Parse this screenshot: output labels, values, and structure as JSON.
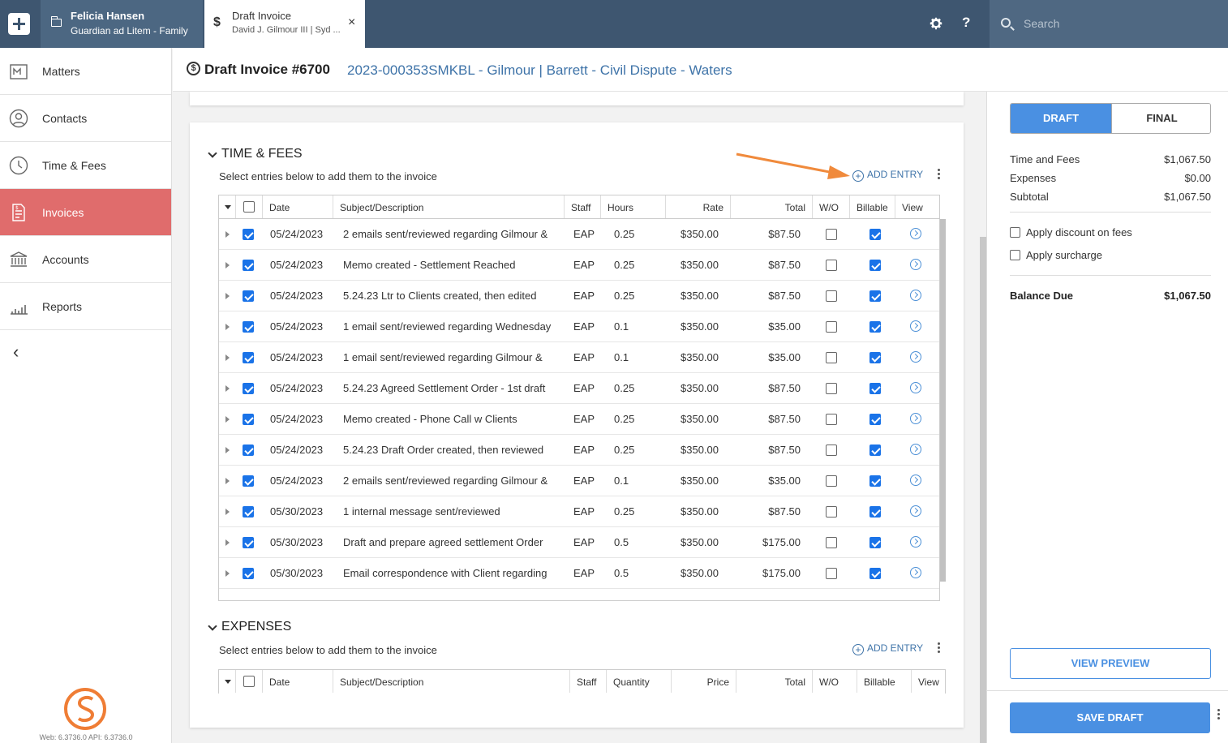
{
  "topbar": {
    "matter_tab": {
      "name": "Felicia Hansen",
      "subtitle": "Guardian ad Litem - Family"
    },
    "invoice_tab": {
      "title": "Draft Invoice",
      "subtitle": "David J. Gilmour III | Syd ...",
      "icon": "$",
      "close": "×"
    },
    "help": "?",
    "search_placeholder": "Search"
  },
  "sidebar": {
    "items": [
      {
        "label": "Matters",
        "icon": "matters-icon"
      },
      {
        "label": "Contacts",
        "icon": "contacts-icon"
      },
      {
        "label": "Time & Fees",
        "icon": "clock-icon"
      },
      {
        "label": "Invoices",
        "icon": "invoice-icon",
        "active": true
      },
      {
        "label": "Accounts",
        "icon": "bank-icon"
      },
      {
        "label": "Reports",
        "icon": "reports-icon"
      }
    ],
    "collapse": "‹",
    "version": "Web: 6.3736.0 API: 6.3736.0"
  },
  "header": {
    "info": "$",
    "title": "Draft Invoice #6700",
    "matter_link": "2023-000353SMKBL - Gilmour | Barrett - Civil Dispute - Waters"
  },
  "time_fees": {
    "title": "TIME & FEES",
    "subtitle": "Select entries below to add them to the invoice",
    "add_entry": "ADD ENTRY",
    "columns": {
      "date": "Date",
      "subject": "Subject/Description",
      "staff": "Staff",
      "hours": "Hours",
      "rate": "Rate",
      "total": "Total",
      "wo": "W/O",
      "billable": "Billable",
      "view": "View"
    },
    "rows": [
      {
        "date": "05/24/2023",
        "subject": "2 emails sent/reviewed regarding Gilmour &",
        "staff": "EAP",
        "hours": "0.25",
        "rate": "$350.00",
        "total": "$87.50",
        "selected": true,
        "wo": false,
        "billable": true
      },
      {
        "date": "05/24/2023",
        "subject": "Memo created - Settlement Reached",
        "staff": "EAP",
        "hours": "0.25",
        "rate": "$350.00",
        "total": "$87.50",
        "selected": true,
        "wo": false,
        "billable": true
      },
      {
        "date": "05/24/2023",
        "subject": "5.24.23 Ltr to Clients created, then edited",
        "staff": "EAP",
        "hours": "0.25",
        "rate": "$350.00",
        "total": "$87.50",
        "selected": true,
        "wo": false,
        "billable": true
      },
      {
        "date": "05/24/2023",
        "subject": "1 email sent/reviewed regarding Wednesday",
        "staff": "EAP",
        "hours": "0.1",
        "rate": "$350.00",
        "total": "$35.00",
        "selected": true,
        "wo": false,
        "billable": true
      },
      {
        "date": "05/24/2023",
        "subject": "1 email sent/reviewed regarding Gilmour &",
        "staff": "EAP",
        "hours": "0.1",
        "rate": "$350.00",
        "total": "$35.00",
        "selected": true,
        "wo": false,
        "billable": true
      },
      {
        "date": "05/24/2023",
        "subject": "5.24.23 Agreed Settlement Order - 1st draft",
        "staff": "EAP",
        "hours": "0.25",
        "rate": "$350.00",
        "total": "$87.50",
        "selected": true,
        "wo": false,
        "billable": true
      },
      {
        "date": "05/24/2023",
        "subject": "Memo created - Phone Call w Clients",
        "staff": "EAP",
        "hours": "0.25",
        "rate": "$350.00",
        "total": "$87.50",
        "selected": true,
        "wo": false,
        "billable": true
      },
      {
        "date": "05/24/2023",
        "subject": "5.24.23 Draft Order created, then reviewed",
        "staff": "EAP",
        "hours": "0.25",
        "rate": "$350.00",
        "total": "$87.50",
        "selected": true,
        "wo": false,
        "billable": true
      },
      {
        "date": "05/24/2023",
        "subject": "2 emails sent/reviewed regarding Gilmour &",
        "staff": "EAP",
        "hours": "0.1",
        "rate": "$350.00",
        "total": "$35.00",
        "selected": true,
        "wo": false,
        "billable": true
      },
      {
        "date": "05/30/2023",
        "subject": "1 internal message sent/reviewed",
        "staff": "EAP",
        "hours": "0.25",
        "rate": "$350.00",
        "total": "$87.50",
        "selected": true,
        "wo": false,
        "billable": true
      },
      {
        "date": "05/30/2023",
        "subject": "Draft and prepare agreed settlement Order",
        "staff": "EAP",
        "hours": "0.5",
        "rate": "$350.00",
        "total": "$175.00",
        "selected": true,
        "wo": false,
        "billable": true
      },
      {
        "date": "05/30/2023",
        "subject": "Email correspondence with Client regarding",
        "staff": "EAP",
        "hours": "0.5",
        "rate": "$350.00",
        "total": "$175.00",
        "selected": true,
        "wo": false,
        "billable": true
      }
    ]
  },
  "expenses": {
    "title": "EXPENSES",
    "subtitle": "Select entries below to add them to the invoice",
    "add_entry": "ADD ENTRY",
    "columns": {
      "date": "Date",
      "subject": "Subject/Description",
      "staff": "Staff",
      "quantity": "Quantity",
      "price": "Price",
      "total": "Total",
      "wo": "W/O",
      "billable": "Billable",
      "view": "View"
    }
  },
  "summary": {
    "draft": "DRAFT",
    "final": "FINAL",
    "time_fees_label": "Time and Fees",
    "time_fees_value": "$1,067.50",
    "expenses_label": "Expenses",
    "expenses_value": "$0.00",
    "subtotal_label": "Subtotal",
    "subtotal_value": "$1,067.50",
    "discount_label": "Apply discount on fees",
    "surcharge_label": "Apply surcharge",
    "balance_label": "Balance Due",
    "balance_value": "$1,067.50",
    "view_preview": "VIEW PREVIEW",
    "save_draft": "SAVE DRAFT"
  },
  "colors": {
    "topbar": "#3e5670",
    "active_nav": "#e06c6c",
    "accent": "#4a90e2",
    "link": "#3e73a8",
    "annotation_arrow": "#f08a3c"
  }
}
